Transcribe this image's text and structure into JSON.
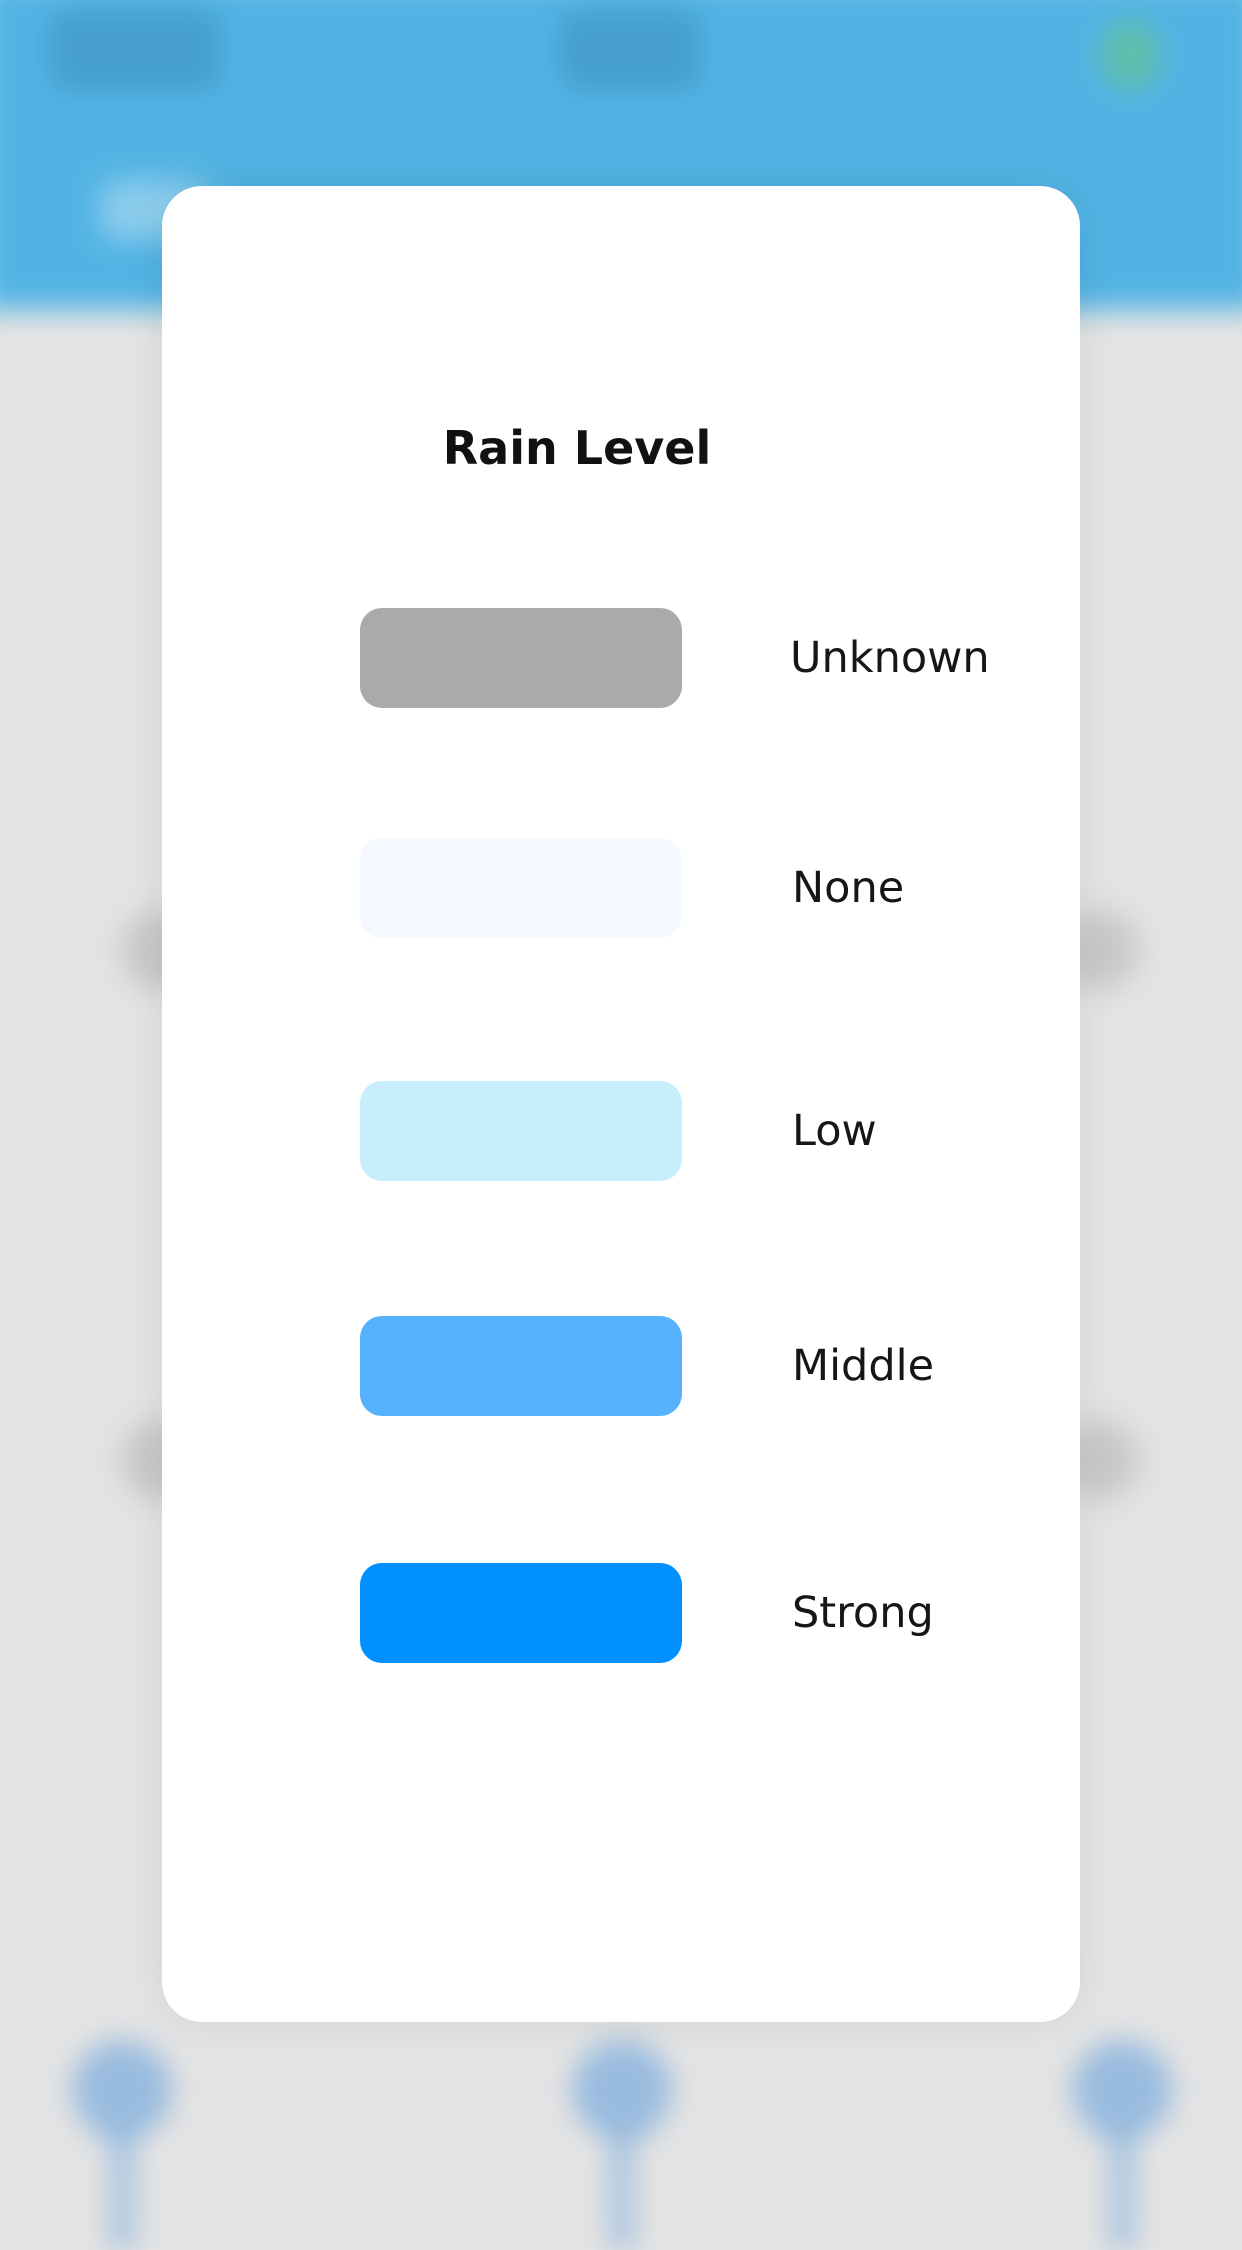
{
  "modal": {
    "title": "Rain Level",
    "items": [
      {
        "label": "Unknown",
        "color": "#aaaaaa"
      },
      {
        "label": "None",
        "color": "#f4f9ff"
      },
      {
        "label": "Low",
        "color": "#c6eefd"
      },
      {
        "label": "Middle",
        "color": "#56b2fd"
      },
      {
        "label": "Strong",
        "color": "#0090ff"
      }
    ]
  },
  "theme": {
    "header_color": "#51b3e4",
    "backdrop_color": "#e4e4e4"
  }
}
